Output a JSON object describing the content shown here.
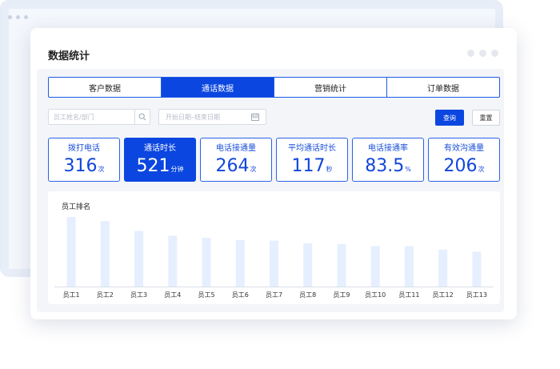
{
  "window": {
    "title": "数据统计"
  },
  "tabs": [
    {
      "label": "客户数据",
      "active": false
    },
    {
      "label": "通话数据",
      "active": true
    },
    {
      "label": "营销统计",
      "active": false
    },
    {
      "label": "订单数据",
      "active": false
    }
  ],
  "filters": {
    "search_placeholder": "员工姓名/部门",
    "search_icon": "search-icon",
    "date_placeholder": "开始日期–结束日期",
    "date_icon": "calendar-icon",
    "query_label": "查询",
    "reset_label": "重置"
  },
  "stats": [
    {
      "label": "拨打电话",
      "value": "316",
      "unit": "次",
      "active": false
    },
    {
      "label": "通话时长",
      "value": "521",
      "unit": "分钟",
      "active": true
    },
    {
      "label": "电话接通量",
      "value": "264",
      "unit": "次",
      "active": false
    },
    {
      "label": "平均通话时长",
      "value": "117",
      "unit": "秒",
      "active": false
    },
    {
      "label": "电话接通率",
      "value": "83.5",
      "unit": "%",
      "active": false
    },
    {
      "label": "有效沟通量",
      "value": "206",
      "unit": "次",
      "active": false
    }
  ],
  "colors": {
    "accent": "#0b46e0",
    "bar": "#e6efff",
    "axis": "#d9dee6"
  },
  "chart_data": {
    "type": "bar",
    "title": "员工排名",
    "categories": [
      "员工1",
      "员工2",
      "员工3",
      "员工4",
      "员工5",
      "员工6",
      "员工7",
      "员工8",
      "员工9",
      "员工10",
      "员工11",
      "员工12",
      "员工13"
    ],
    "values": [
      100,
      94,
      80,
      73,
      70,
      67,
      66,
      62,
      61,
      58,
      58,
      53,
      50
    ],
    "ylim": [
      0,
      100
    ],
    "xlabel": "",
    "ylabel": "",
    "grid": false,
    "legend": "none"
  }
}
